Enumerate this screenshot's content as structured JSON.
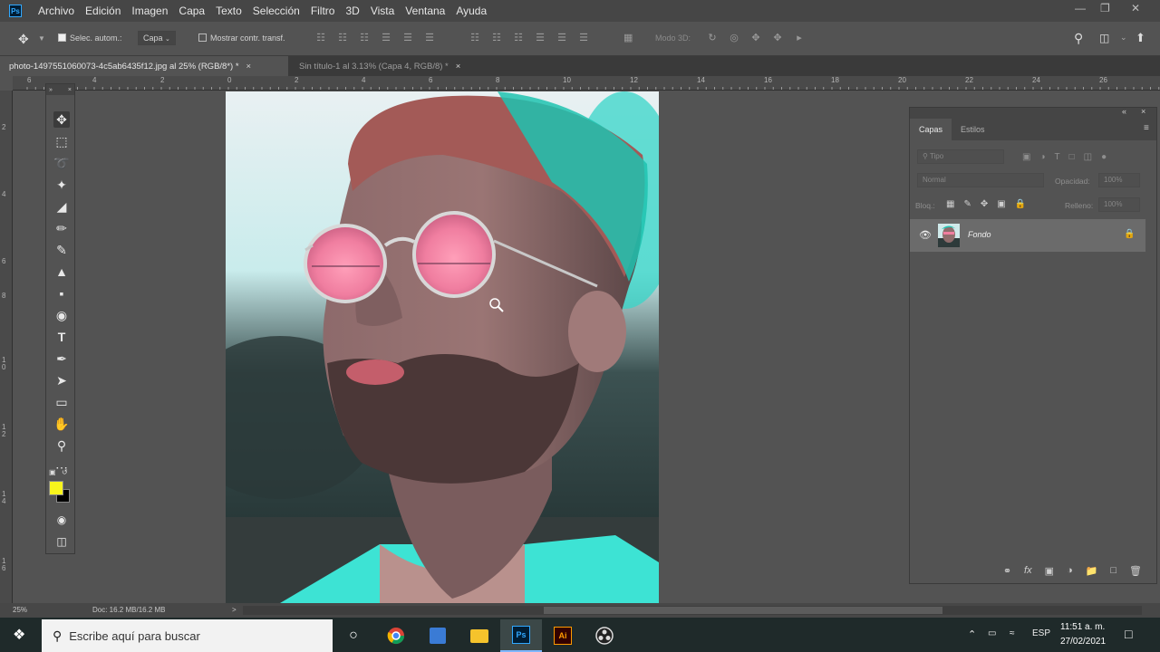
{
  "menubar": {
    "app_badge": "Ps",
    "items": [
      "Archivo",
      "Edición",
      "Imagen",
      "Capa",
      "Texto",
      "Selección",
      "Filtro",
      "3D",
      "Vista",
      "Ventana",
      "Ayuda"
    ]
  },
  "options": {
    "auto_select_label": "Selec. autom.:",
    "auto_select_target": "Capa",
    "show_transform_label": "Mostrar contr. transf.",
    "mode_3d_label": "Modo 3D:"
  },
  "tabs": [
    {
      "label": "photo-1497551060073-4c5ab6435f12.jpg al 25% (RGB/8*) *",
      "close": "×"
    },
    {
      "label": "Sin título-1 al 3.13% (Capa 4, RGB/8) *",
      "close": "×"
    }
  ],
  "rulers": {
    "h_ticks": [
      "6",
      "4",
      "2",
      "0",
      "2",
      "4",
      "6",
      "8",
      "10",
      "12",
      "14",
      "16",
      "18",
      "20",
      "22",
      "24",
      "26"
    ],
    "v_ticks": [
      "2",
      "4",
      "6",
      "8",
      "1 0",
      "1 2",
      "1 4",
      "1 6"
    ]
  },
  "layers_panel": {
    "tabs": [
      "Capas",
      "Estilos"
    ],
    "filter_placeholder": "Tipo",
    "blend_mode": "Normal",
    "opacity_label": "Opacidad:",
    "opacity_value": "100%",
    "lock_label": "Bloq.:",
    "fill_label": "Relleno:",
    "fill_value": "100%",
    "layer_name": "Fondo"
  },
  "status": {
    "zoom": "25%",
    "doc_info": "Doc: 16.2 MB/16.2 MB",
    "arrow": ">"
  },
  "taskbar": {
    "search_placeholder": "Escribe aquí para buscar",
    "language": "ESP",
    "time": "11:51 a. m.",
    "date": "27/02/2021"
  },
  "colors": {
    "foreground": "#f8f51c",
    "background": "#000000",
    "accent": "#31a8ff"
  }
}
